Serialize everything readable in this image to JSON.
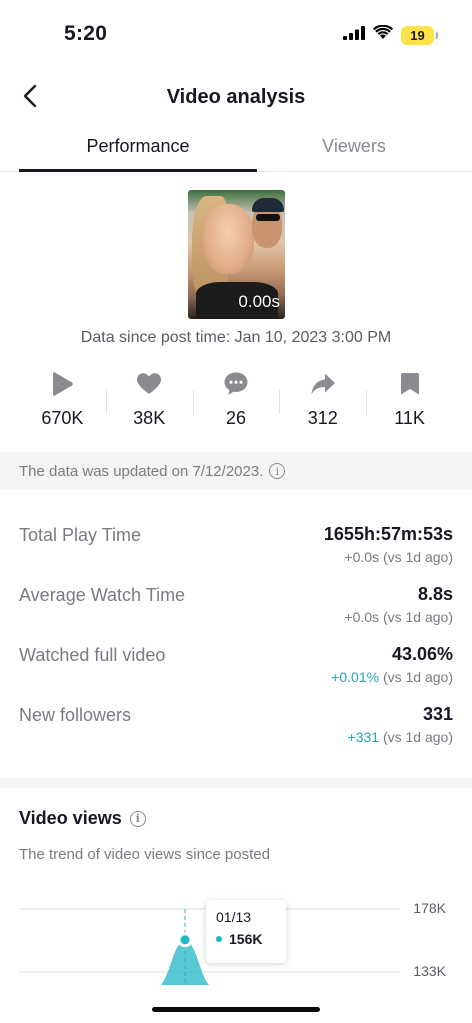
{
  "status_bar": {
    "time": "5:20",
    "battery": "19"
  },
  "header": {
    "title": "Video analysis"
  },
  "tabs": [
    {
      "label": "Performance",
      "active": true
    },
    {
      "label": "Viewers",
      "active": false
    }
  ],
  "video": {
    "duration": "0.00s",
    "post_time": "Data since post time: Jan 10, 2023 3:00 PM"
  },
  "stats": [
    {
      "icon": "play-icon",
      "value": "670K"
    },
    {
      "icon": "heart-icon",
      "value": "38K"
    },
    {
      "icon": "comment-icon",
      "value": "26"
    },
    {
      "icon": "share-icon",
      "value": "312"
    },
    {
      "icon": "bookmark-icon",
      "value": "11K"
    }
  ],
  "update_banner": {
    "text": "The data was updated on 7/12/2023."
  },
  "metrics": [
    {
      "label": "Total Play Time",
      "value": "1655h:57m:53s",
      "delta": "+0.0s",
      "delta_suffix": " (vs 1d ago)",
      "delta_positive": false
    },
    {
      "label": "Average Watch Time",
      "value": "8.8s",
      "delta": "+0.0s",
      "delta_suffix": " (vs 1d ago)",
      "delta_positive": false
    },
    {
      "label": "Watched full video",
      "value": "43.06%",
      "delta": "+0.01%",
      "delta_suffix": " (vs 1d ago)",
      "delta_positive": true
    },
    {
      "label": "New followers",
      "value": "331",
      "delta": "+331",
      "delta_suffix": " (vs 1d ago)",
      "delta_positive": true
    }
  ],
  "video_views": {
    "title": "Video views",
    "subtitle": "The trend of video views since posted"
  },
  "chart_data": {
    "type": "area",
    "title": "Video views",
    "y_ticks": [
      "178K",
      "133K"
    ],
    "y_tick_values": [
      178000,
      133000
    ],
    "points": [
      {
        "x": "01/13",
        "y": 156000
      }
    ],
    "tooltip": {
      "date": "01/13",
      "value": "156K"
    },
    "accent_color": "#20b6c7"
  },
  "colors": {
    "accent": "#20b6c7",
    "positive": "#20a7b4",
    "battery": "#ffe14a"
  }
}
